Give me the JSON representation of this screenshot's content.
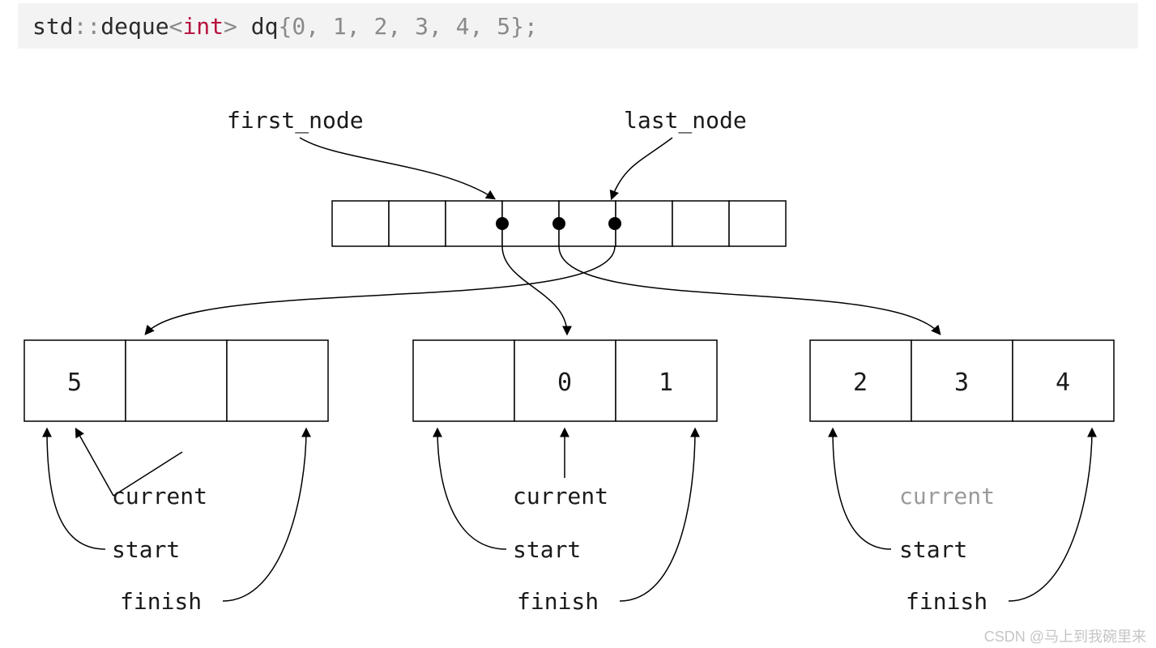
{
  "code": {
    "ns": "std",
    "colons": "::",
    "cls": "deque",
    "lt": "<",
    "type": "int",
    "gt": ">",
    "sp": " ",
    "var": "dq",
    "lbrace": "{",
    "v0": "0",
    "v1": "1",
    "v2": "2",
    "v3": "3",
    "v4": "4",
    "v5": "5",
    "comma": ", ",
    "rbrace": "}",
    "semi": ";"
  },
  "labels": {
    "first_node": "first_node",
    "last_node": "last_node",
    "current": "current",
    "start": "start",
    "finish": "finish"
  },
  "map_cells": 8,
  "map_filled": [
    3,
    4,
    5
  ],
  "chunks": [
    {
      "cells": [
        "5",
        "",
        ""
      ],
      "current_faded": false
    },
    {
      "cells": [
        "",
        "0",
        "1"
      ],
      "current_faded": false
    },
    {
      "cells": [
        "2",
        "3",
        "4"
      ],
      "current_faded": true
    }
  ],
  "watermark": "CSDN @马上到我碗里来"
}
